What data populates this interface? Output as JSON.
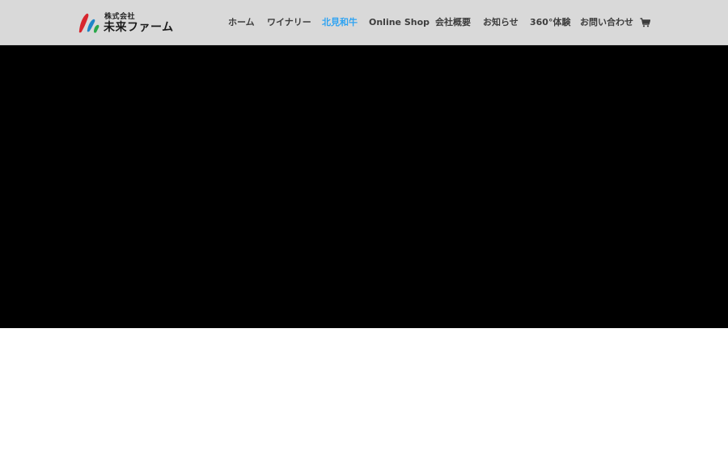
{
  "brand": {
    "company_type": "株式会社",
    "name": "未来ファーム",
    "colors": {
      "red": "#d7262e",
      "blue": "#1f86c8",
      "green": "#2aa84a"
    }
  },
  "nav": {
    "items": [
      {
        "label": "ホーム",
        "active": false
      },
      {
        "label": "ワイナリー",
        "active": false
      },
      {
        "label": "北見和牛",
        "active": true
      },
      {
        "label": "Online Shop",
        "active": false
      },
      {
        "label": "会社概要",
        "active": false
      },
      {
        "label": "お知らせ",
        "active": false
      },
      {
        "label": "360°体験",
        "active": false
      },
      {
        "label": "お問い合わせ",
        "active": false
      }
    ],
    "cart_icon": "shopping-cart-icon",
    "active_color": "#2ea3f2",
    "text_color": "#3d3d3d",
    "header_bg": "#d9d9d9"
  },
  "hero": {
    "background": "#000000"
  }
}
